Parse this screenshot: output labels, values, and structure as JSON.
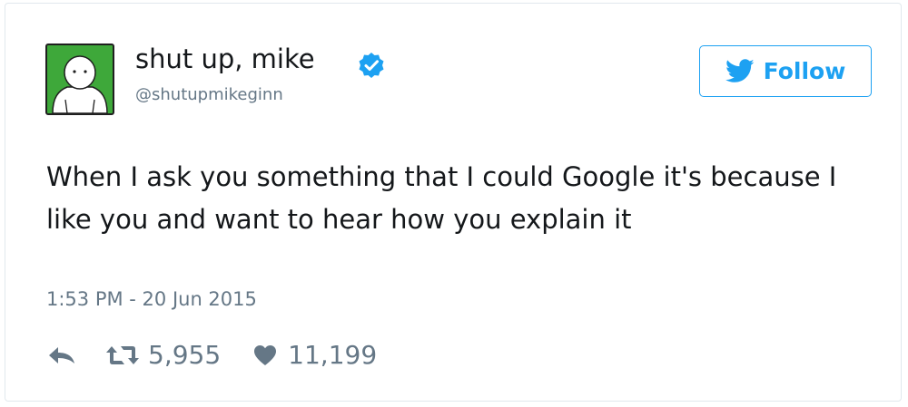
{
  "user": {
    "display_name": "shut up, mike",
    "handle": "@shutupmikeginn",
    "verified_icon": "verified-badge-icon",
    "avatar_bg": "#3ea83a"
  },
  "follow": {
    "label": "Follow",
    "icon": "twitter-bird-icon",
    "color": "#1da1f2"
  },
  "tweet": {
    "text": "When I ask you something that I could Google it's because I like you and want to hear how you explain it",
    "timestamp": "1:53 PM - 20 Jun 2015"
  },
  "actions": {
    "reply_icon": "reply-icon",
    "retweet_icon": "retweet-icon",
    "retweet_count": "5,955",
    "like_icon": "heart-icon",
    "like_count": "11,199"
  },
  "colors": {
    "text": "#14171a",
    "secondary": "#657786",
    "border": "#e1e8ed"
  }
}
